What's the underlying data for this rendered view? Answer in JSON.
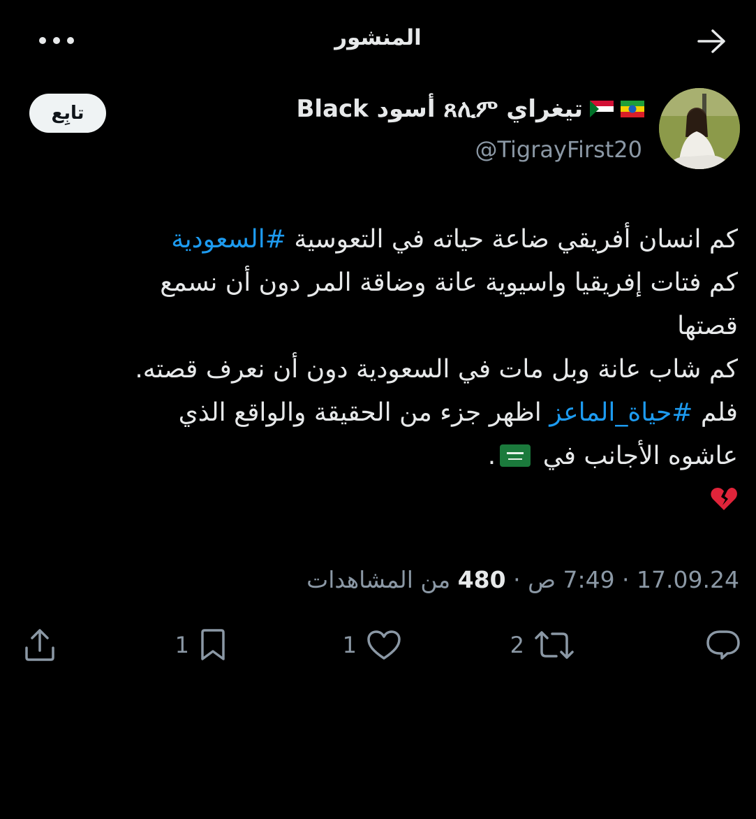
{
  "header": {
    "title": "المنشور",
    "back_icon": "arrow-right-icon",
    "more_icon": "more-horizontal-icon"
  },
  "author": {
    "display_name": "تيغراي ጸሊም أسود Black",
    "handle": "@TigrayFirst20",
    "flags": [
      "ethiopia-flag-icon",
      "sudan-flag-icon"
    ]
  },
  "follow": {
    "label": "تابِع"
  },
  "tweet": {
    "line1_text": "كم انسان أفريقي ضاعة حياته في التعوسية ",
    "line1_hashtag": "#السعودية",
    "line2": "كم فتات إفريقيا واسيوية عانة وضاقة المر دون أن نسمع",
    "line3": "قصتها",
    "line4": "كم شاب عانة وبل مات في السعودية دون أن نعرف قصته.",
    "line5_prefix": "فلم ",
    "line5_hashtag": "#حياة_الماعز",
    "line5_suffix": "  اظهر جزء من الحقيقة والواقع الذي",
    "line6_text": "عاشوه الأجانب في",
    "line6_end": ".",
    "emoji_flag": "saudi-flag-icon",
    "emoji_heart": "broken-heart-icon"
  },
  "meta": {
    "date": "17.09.24",
    "separator": " · ",
    "time": "7:49 ص",
    "views_count": "480",
    "views_label": " من المشاهدات"
  },
  "actions": {
    "reply_count": "",
    "retweet_count": "2",
    "like_count": "1",
    "bookmark_count": "1"
  },
  "colors": {
    "background": "#000000",
    "text": "#e7e9ea",
    "secondary": "#8b98a5",
    "link": "#1d9bf0"
  }
}
